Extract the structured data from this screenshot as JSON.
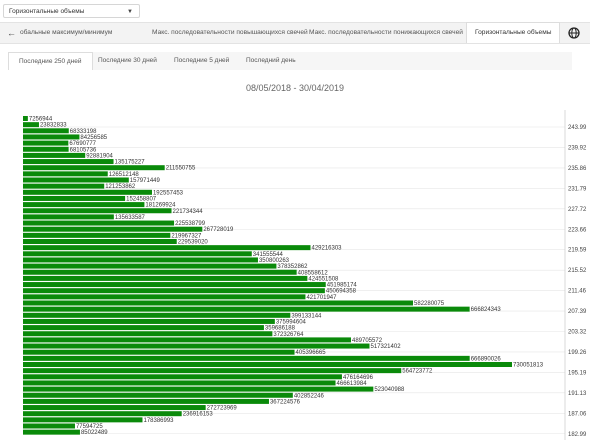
{
  "selector": {
    "value": "Горизонтальные объемы",
    "caret": "▼"
  },
  "tabs": {
    "arrow": "←",
    "items": [
      {
        "label": "обальные максимум/минимум"
      },
      {
        "label": "Макс. последовательности повышающихся свечей"
      },
      {
        "label": "Макс. последовательности понижающихся свечей"
      },
      {
        "label": "Горизонтальные объемы"
      }
    ],
    "active": 3
  },
  "periods": {
    "items": [
      {
        "label": "Последние 250 дней"
      },
      {
        "label": "Последние 30 дней"
      },
      {
        "label": "Последние 5 дней"
      },
      {
        "label": "Последний день"
      }
    ],
    "active": 0
  },
  "date_range": "08/05/2018 - 30/04/2019",
  "chart_data": {
    "type": "bar",
    "orientation": "horizontal",
    "xlim": [
      0,
      730051813
    ],
    "bar_color": "#0a8a0a",
    "values": [
      7256944,
      23832833,
      68333198,
      84256585,
      67690777,
      68105736,
      92881904,
      135175227,
      211550755,
      126512148,
      157971449,
      121253862,
      192557453,
      152458807,
      181269924,
      221734344,
      135633587,
      225538799,
      267728019,
      219967327,
      229539020,
      429216303,
      341555544,
      350800263,
      378352862,
      408558612,
      424551508,
      451985174,
      450694358,
      421701947,
      582280075,
      666824343,
      399133144,
      375994604,
      359686188,
      372326764,
      489705572,
      517321402,
      405396665,
      666890026,
      730051813,
      564723772,
      476164696,
      466613984,
      523040988,
      402852246,
      367224576,
      272723969,
      236916153,
      178386993,
      77594725,
      85022489
    ],
    "y_ticks": [
      "243.99",
      "239.92",
      "235.86",
      "231.79",
      "227.72",
      "223.66",
      "219.59",
      "215.52",
      "211.46",
      "207.39",
      "203.32",
      "199.26",
      "195.19",
      "191.13",
      "187.06",
      "182.99",
      "178.93"
    ]
  }
}
